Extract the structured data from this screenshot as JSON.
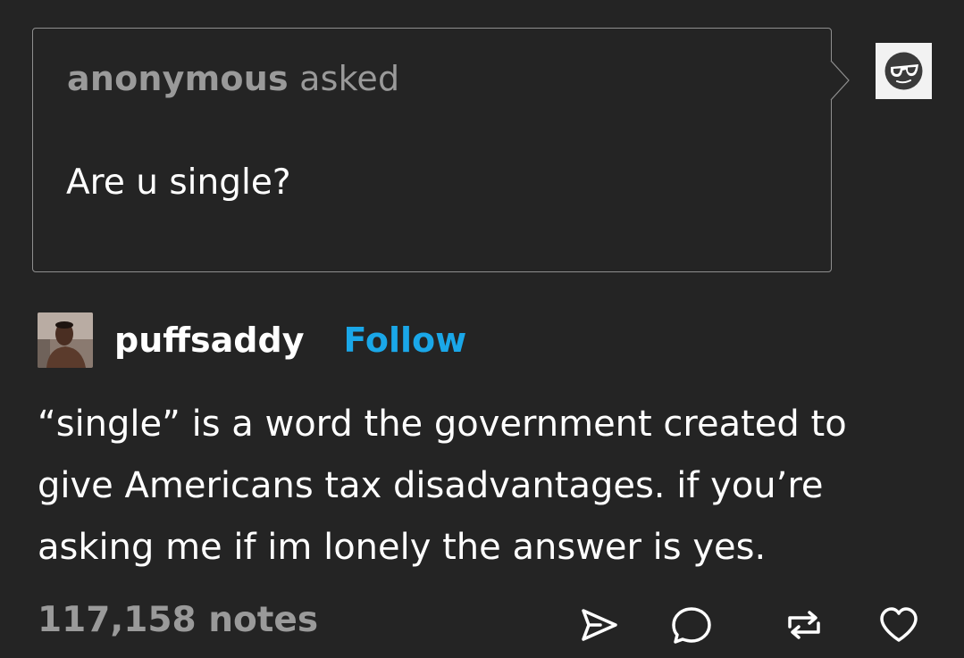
{
  "ask": {
    "asker": "anonymous",
    "asked_label": "asked",
    "question": "Are u single?",
    "avatar_icon": "sunglasses-face-icon"
  },
  "post": {
    "username": "puffsaddy",
    "follow_label": "Follow",
    "body": "“single” is a word the government created to give Americans tax disadvantages. if you’re asking me if im lonely the answer is yes."
  },
  "footer": {
    "notes": "117,158 notes",
    "icons": [
      "share-icon",
      "reply-icon",
      "reblog-icon",
      "like-icon"
    ]
  },
  "colors": {
    "background": "#242424",
    "follow": "#1aa7e8",
    "muted": "#9a9a9a"
  }
}
